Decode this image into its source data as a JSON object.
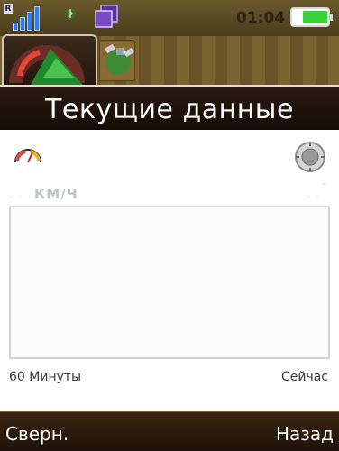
{
  "status_bar": {
    "clock": "01:04",
    "signal_icon": "signal-bars-icon",
    "battery_icon": "battery-icon",
    "colors": {
      "signal": "#2f7df0",
      "battery": "#3bd13b"
    }
  },
  "tabs": [
    {
      "icon": "speedometer-icon",
      "active": true
    },
    {
      "icon": "satellite-icon",
      "active": false
    }
  ],
  "title": "Текущие данные",
  "content": {
    "unit_label": "КМ/Ч",
    "graph": {
      "x_start_label": "60 Минуты",
      "x_end_label": "Сейчас"
    }
  },
  "softkeys": {
    "left": "Сверн.",
    "right": "Назад"
  }
}
